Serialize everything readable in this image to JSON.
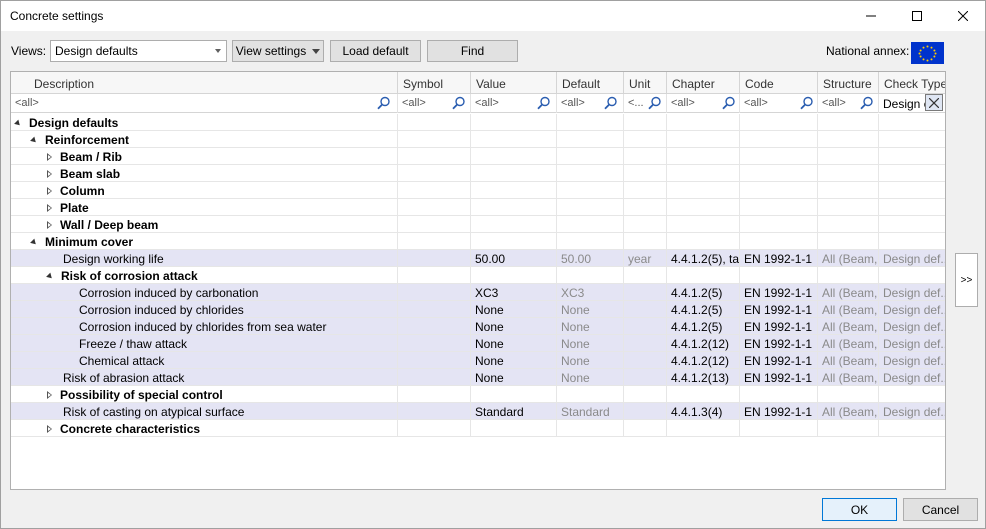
{
  "window": {
    "title": "Concrete settings"
  },
  "toolbar": {
    "views_label": "Views:",
    "views_value": "Design defaults",
    "view_settings": "View settings",
    "load_default": "Load default",
    "find": "Find",
    "national_annex_label": "National annex:"
  },
  "columns": [
    "Description",
    "Symbol",
    "Value",
    "Default",
    "Unit",
    "Chapter",
    "Code",
    "Structure",
    "Check Type"
  ],
  "filters": [
    "<all>",
    "<all>",
    "<all>",
    "<all>",
    "<...",
    "<all>",
    "<all>",
    "<all>",
    "Design c"
  ],
  "rows": [
    {
      "d": "Design defaults",
      "s": "",
      "v": "",
      "df": "",
      "u": "",
      "ch": "",
      "c": "",
      "st": "",
      "ct": ""
    },
    {
      "d": "Reinforcement",
      "s": "",
      "v": "",
      "df": "",
      "u": "",
      "ch": "",
      "c": "",
      "st": "",
      "ct": ""
    },
    {
      "d": "Beam / Rib",
      "s": "",
      "v": "",
      "df": "",
      "u": "",
      "ch": "",
      "c": "",
      "st": "",
      "ct": ""
    },
    {
      "d": "Beam slab",
      "s": "",
      "v": "",
      "df": "",
      "u": "",
      "ch": "",
      "c": "",
      "st": "",
      "ct": ""
    },
    {
      "d": "Column",
      "s": "",
      "v": "",
      "df": "",
      "u": "",
      "ch": "",
      "c": "",
      "st": "",
      "ct": ""
    },
    {
      "d": "Plate",
      "s": "",
      "v": "",
      "df": "",
      "u": "",
      "ch": "",
      "c": "",
      "st": "",
      "ct": ""
    },
    {
      "d": "Wall / Deep beam",
      "s": "",
      "v": "",
      "df": "",
      "u": "",
      "ch": "",
      "c": "",
      "st": "",
      "ct": ""
    },
    {
      "d": "Minimum cover",
      "s": "",
      "v": "",
      "df": "",
      "u": "",
      "ch": "",
      "c": "",
      "st": "",
      "ct": ""
    },
    {
      "d": "Design working life",
      "s": "",
      "v": "50.00",
      "df": "50.00",
      "u": "year",
      "ch": "4.4.1.2(5), ta...",
      "c": "EN 1992-1-1",
      "st": "All (Beam,...",
      "ct": "Design def..."
    },
    {
      "d": "Risk of corrosion attack",
      "s": "",
      "v": "",
      "df": "",
      "u": "",
      "ch": "",
      "c": "",
      "st": "",
      "ct": ""
    },
    {
      "d": "Corrosion induced by carbonation",
      "s": "",
      "v": "XC3",
      "df": "XC3",
      "u": "",
      "ch": "4.4.1.2(5)",
      "c": "EN 1992-1-1",
      "st": "All (Beam,...",
      "ct": "Design def..."
    },
    {
      "d": "Corrosion induced by chlorides",
      "s": "",
      "v": "None",
      "df": "None",
      "u": "",
      "ch": "4.4.1.2(5)",
      "c": "EN 1992-1-1",
      "st": "All (Beam,...",
      "ct": "Design def..."
    },
    {
      "d": "Corrosion induced by chlorides from sea water",
      "s": "",
      "v": "None",
      "df": "None",
      "u": "",
      "ch": "4.4.1.2(5)",
      "c": "EN 1992-1-1",
      "st": "All (Beam,...",
      "ct": "Design def..."
    },
    {
      "d": "Freeze / thaw attack",
      "s": "",
      "v": "None",
      "df": "None",
      "u": "",
      "ch": "4.4.1.2(12)",
      "c": "EN 1992-1-1",
      "st": "All (Beam,...",
      "ct": "Design def..."
    },
    {
      "d": "Chemical attack",
      "s": "",
      "v": "None",
      "df": "None",
      "u": "",
      "ch": "4.4.1.2(12)",
      "c": "EN 1992-1-1",
      "st": "All (Beam,...",
      "ct": "Design def..."
    },
    {
      "d": "Risk of abrasion attack",
      "s": "",
      "v": "None",
      "df": "None",
      "u": "",
      "ch": "4.4.1.2(13)",
      "c": "EN 1992-1-1",
      "st": "All (Beam,...",
      "ct": "Design def..."
    },
    {
      "d": "Possibility of special control",
      "s": "",
      "v": "",
      "df": "",
      "u": "",
      "ch": "",
      "c": "",
      "st": "",
      "ct": ""
    },
    {
      "d": "Risk of casting on atypical surface",
      "s": "",
      "v": "Standard",
      "df": "Standard",
      "u": "",
      "ch": "4.4.1.3(4)",
      "c": "EN 1992-1-1",
      "st": "All (Beam,...",
      "ct": "Design def..."
    },
    {
      "d": "Concrete characteristics",
      "s": "",
      "v": "",
      "df": "",
      "u": "",
      "ch": "",
      "c": "",
      "st": "",
      "ct": ""
    }
  ],
  "side_button": ">>",
  "footer": {
    "ok": "OK",
    "cancel": "Cancel"
  }
}
